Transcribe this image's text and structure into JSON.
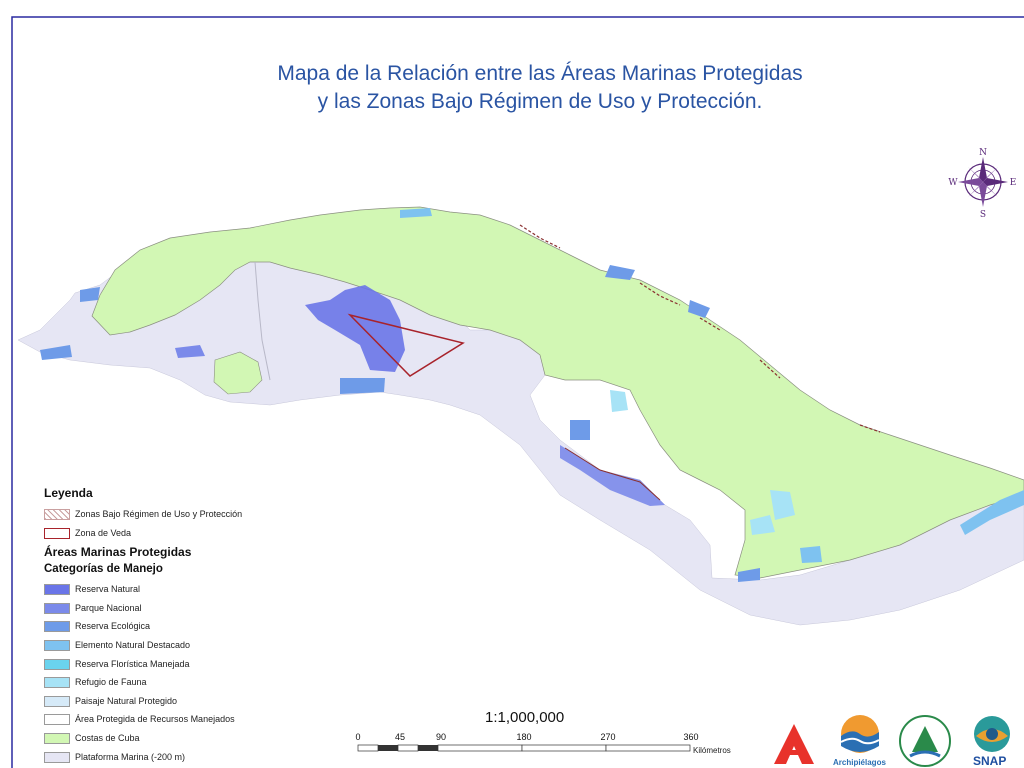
{
  "map": {
    "title_line1": "Mapa de la Relación entre las Áreas Marinas Protegidas",
    "title_line2": "y las Zonas Bajo Régimen de Uso y Protección.",
    "colors": {
      "land": "#d2f7b4",
      "platform": "#e6e6f4",
      "reserva_natural": "#6a75e8",
      "parque_nacional": "#7b8aea",
      "reserva_ecologica": "#6e9be8",
      "elemento_natural": "#7ec2f0",
      "reserva_floristica": "#6ad3ee",
      "refugio_fauna": "#a7e3f6",
      "paisaje": "#d6eaf8",
      "veda": "#a8232b",
      "title": "#2a54a3",
      "border": "#2a2aa0"
    }
  },
  "compass": {
    "n": "N",
    "s": "S",
    "e": "E",
    "w": "W",
    "icon": "compass-rose-icon"
  },
  "legend": {
    "heading": "Leyenda",
    "items_top": [
      {
        "label": "Zonas Bajo Régimen de Uso y Protección",
        "swatch": "hatched"
      },
      {
        "label": "Zona de Veda",
        "swatch": "red-outline"
      }
    ],
    "section_title": "Áreas Marinas Protegidas",
    "subsection_title": "Categorías de Manejo",
    "categories": [
      {
        "label": "Reserva Natural",
        "color": "#6a75e8"
      },
      {
        "label": "Parque Nacional",
        "color": "#7b8aea"
      },
      {
        "label": "Reserva Ecológica",
        "color": "#6e9be8"
      },
      {
        "label": "Elemento Natural Destacado",
        "color": "#7ec2f0"
      },
      {
        "label": "Reserva Florística Manejada",
        "color": "#6ad3ee"
      },
      {
        "label": "Refugio de Fauna",
        "color": "#a7e3f6"
      },
      {
        "label": "Paisaje Natural Protegido",
        "color": "#d6eaf8"
      },
      {
        "label": "Área Protegida de Recursos Manejados",
        "color": "#ffffff"
      },
      {
        "label": "Costas de Cuba",
        "color": "#d2f7b4"
      },
      {
        "label": "Plataforma Marina (-200 m)",
        "color": "#e6e6f4"
      }
    ]
  },
  "scale": {
    "ratio": "1:1,000,000",
    "ticks": [
      "0",
      "45",
      "90",
      "180",
      "270",
      "360"
    ],
    "unit": "Kilómetros"
  },
  "logos": {
    "archipielagos": "Archipiélagos",
    "snap": "SNAP"
  }
}
